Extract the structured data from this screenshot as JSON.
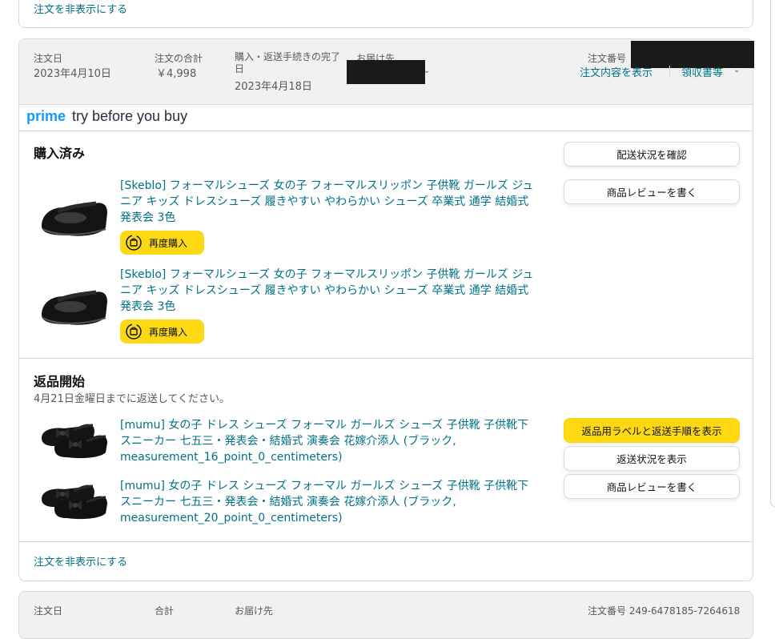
{
  "top_card": {
    "hide_order_link": "注文を非表示にする"
  },
  "order": {
    "header": {
      "date_label": "注文日",
      "date_value": "2023年4月10日",
      "total_label": "注文の合計",
      "total_value": "￥4,998",
      "deadline_label": "購入・返送手続きの完了日",
      "deadline_value": "2023年4月18日",
      "ship_to_label": "お届け先",
      "order_number_label": "注文番号",
      "view_details_link": "注文内容を表示",
      "receipt_link": "領収書等"
    },
    "prime_banner": {
      "prime": "prime",
      "text": "try before you buy"
    },
    "purchased": {
      "heading": "購入済み",
      "track_button": "配送状況を確認",
      "review_button": "商品レビューを書く",
      "items": [
        {
          "title": "[Skeblo] フォーマルシューズ 女の子 フォーマルスリッポン 子供靴 ガールズ ジュニア キッズ ドレスシューズ 履きやすい やわらかい シューズ 卒業式 通学 結婚式 発表会 3色",
          "rebuy_label": "再度購入"
        },
        {
          "title": "[Skeblo] フォーマルシューズ 女の子 フォーマルスリッポン 子供靴 ガールズ ジュニア キッズ ドレスシューズ 履きやすい やわらかい シューズ 卒業式 通学 結婚式 発表会 3色",
          "rebuy_label": "再度購入"
        }
      ]
    },
    "return": {
      "heading": "返品開始",
      "subtitle": "4月21日金曜日までに返送してください。",
      "label_button": "返品用ラベルと返送手順を表示",
      "status_button": "返送状況を表示",
      "review_button": "商品レビューを書く",
      "items": [
        {
          "title": "[mumu] 女の子 ドレス シューズ フォーマル ガールズ シューズ 子供靴 子供靴下 スニーカー 七五三・発表会・結婚式 演奏会 花嫁介添人 (ブラック, measurement_16_point_0_centimeters)"
        },
        {
          "title": "[mumu] 女の子 ドレス シューズ フォーマル ガールズ シューズ 子供靴 子供靴下 スニーカー 七五三・発表会・結婚式 演奏会 花嫁介添人 (ブラック, measurement_20_point_0_centimeters)"
        }
      ]
    },
    "hide_order_link": "注文を非表示にする"
  },
  "next_order": {
    "date_label": "注文日",
    "total_label": "合計",
    "ship_to_label": "お届け先",
    "order_number": "注文番号 249-6478185-7264618"
  },
  "colors": {
    "link": "#007185",
    "button_yellow": "#ffd814",
    "header_bg": "#f0f2f2",
    "prime_blue": "#1399ff"
  }
}
